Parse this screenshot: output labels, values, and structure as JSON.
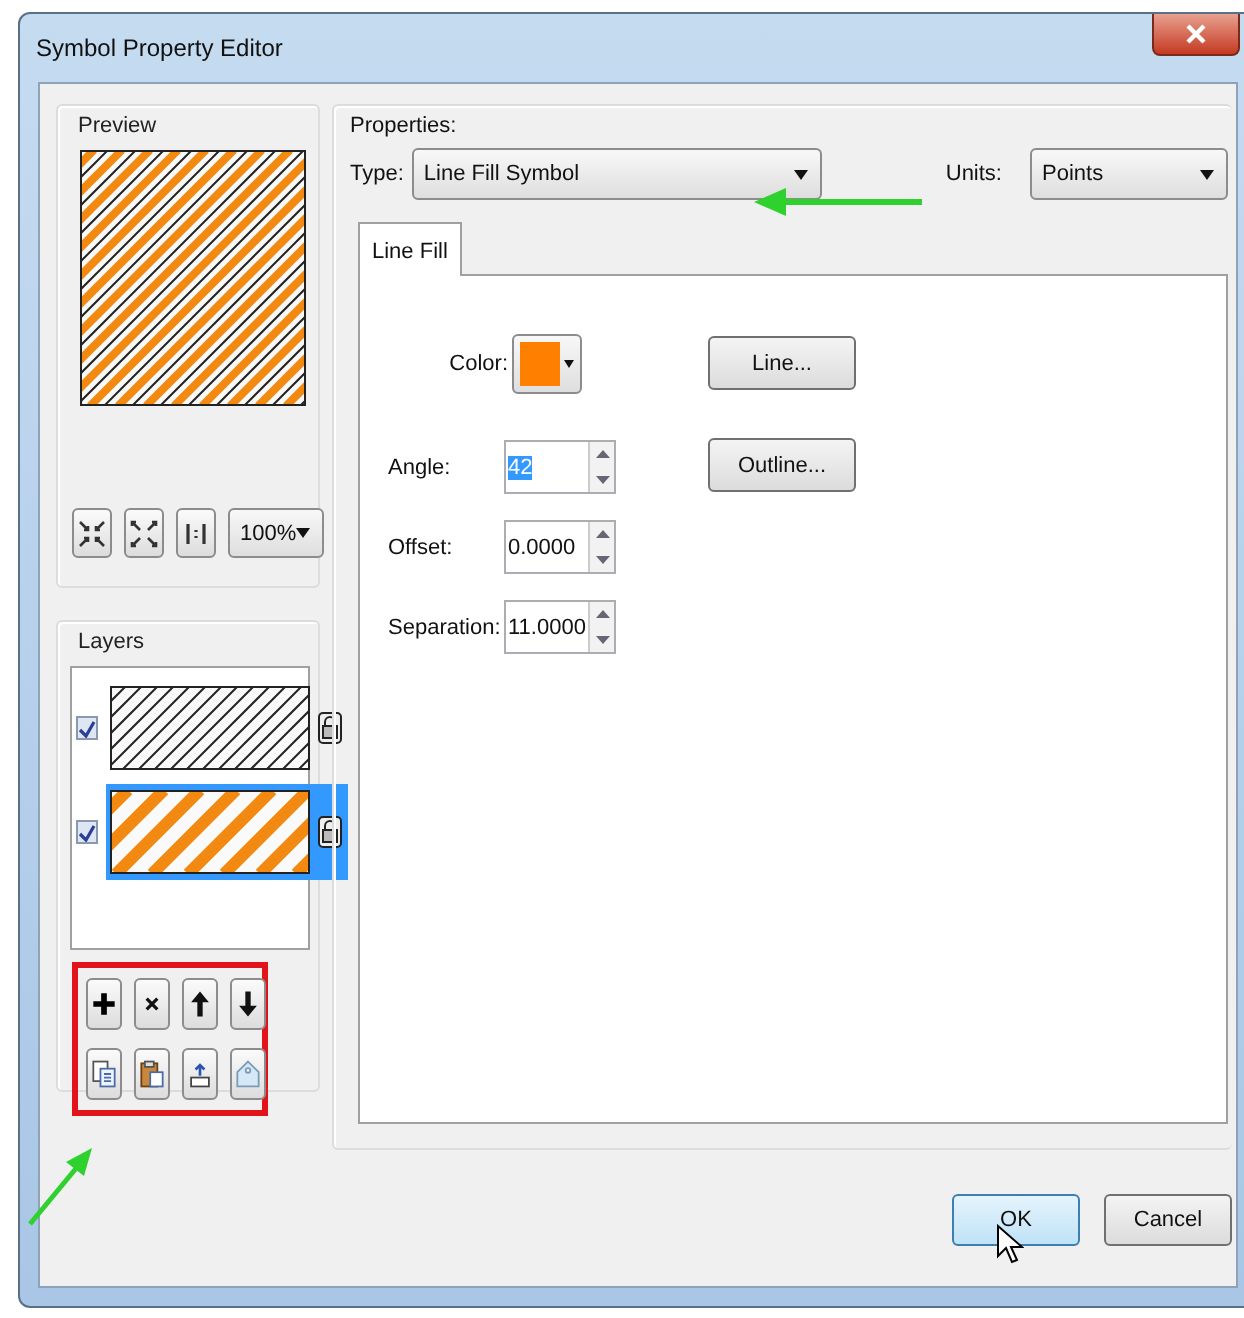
{
  "window": {
    "title": "Symbol Property Editor"
  },
  "preview": {
    "label": "Preview",
    "zoom": "100%"
  },
  "layers": {
    "label": "Layers",
    "items": [
      {
        "kind": "hatch",
        "checked": true,
        "selected": false
      },
      {
        "kind": "stripes",
        "checked": true,
        "selected": true
      }
    ]
  },
  "properties": {
    "label": "Properties:",
    "type_label": "Type:",
    "type_value": "Line Fill Symbol",
    "units_label": "Units:",
    "units_value": "Points"
  },
  "tabs": [
    {
      "label": "Line Fill",
      "selected": true
    }
  ],
  "fields": [
    {
      "kind": "color",
      "label": "Color:",
      "color": "#ff8000"
    },
    {
      "kind": "spin",
      "label": "Angle:",
      "value": "42",
      "highlighted": true
    },
    {
      "kind": "spin",
      "label": "Offset:",
      "value": "0.0000",
      "highlighted": false
    },
    {
      "kind": "spin",
      "label": "Separation:",
      "value": "11.0000",
      "highlighted": false
    }
  ],
  "side_buttons": [
    "Line...",
    "Outline..."
  ],
  "buttons": [
    {
      "label": "OK",
      "focused": true
    },
    {
      "label": "Cancel",
      "focused": false
    }
  ]
}
